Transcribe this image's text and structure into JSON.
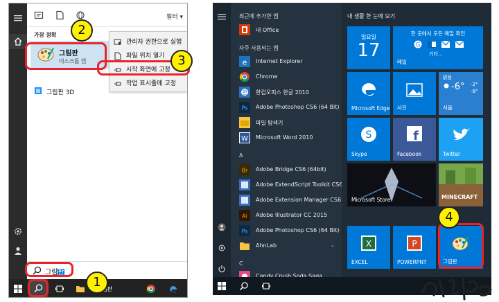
{
  "left": {
    "filter_label": "필터",
    "best_match_label": "가장 정확",
    "paint": {
      "name": "그림판",
      "subtitle": "데스크톱 앱"
    },
    "paint3d": {
      "name": "그림판 3D"
    },
    "context_menu": [
      {
        "label": "관리자 권한으로 실행",
        "icon": "admin-shield-icon"
      },
      {
        "label": "파일 위치 열기",
        "icon": "file-location-icon"
      },
      {
        "label": "시작 화면에 고정",
        "icon": "pin-icon"
      },
      {
        "label": "작업 표시줄에 고정",
        "icon": "pin-icon"
      }
    ],
    "search": {
      "query_prefix": "그림",
      "query_highlight": "판"
    },
    "taskbar_paint_label": "그림판"
  },
  "right": {
    "list_header": "최근에 추가한 앱",
    "recent_app": "내 Office",
    "frequent_header": "자주 사용되는 앱",
    "frequent_apps": [
      "Internet Explorer",
      "Chrome",
      "한컴오피스 한글 2010",
      "Adobe Photoshop CS6 (64 Bit)",
      "파일 탐색기",
      "Microsoft Word 2010"
    ],
    "section_a": "A",
    "a_apps": [
      "Adobe Bridge CS6 (64bit)",
      "Adobe ExtendScript Toolkit CS6",
      "Adobe Extension Manager CS6",
      "Adobe Illustrator CC 2015",
      "Adobe Photoshop CS6 (64 Bit)",
      "AhnLab"
    ],
    "section_c": "C",
    "c_apps": [
      "Candy Crush Soda Saga"
    ],
    "tiles_header": "내 생활 한 눈에 보기",
    "tiles": {
      "calendar": {
        "day": "일요일",
        "date": "17"
      },
      "mail": {
        "top": "한 곳에서 모든 메일 확인",
        "etc": "기타...",
        "label": "메일"
      },
      "edge": "Microsoft Edge",
      "photos": "사진",
      "weather": {
        "condition": "맑음",
        "temp": "-6°",
        "hi": "-2°",
        "lo": "-8°",
        "city": "서울"
      },
      "skype": "Skype",
      "facebook": "Facebook",
      "twitter": "Twitter",
      "store": "Microsoft Store",
      "minecraft": "MINECRAFT",
      "excel": "EXCEL",
      "powerpoint": "POWERPNT",
      "paint": "그림판"
    }
  },
  "badges": [
    "1",
    "2",
    "3",
    "4"
  ],
  "colors": {
    "accent": "#0078d7",
    "annotation_red": "#e8232a",
    "badge_yellow": "#fff200"
  }
}
